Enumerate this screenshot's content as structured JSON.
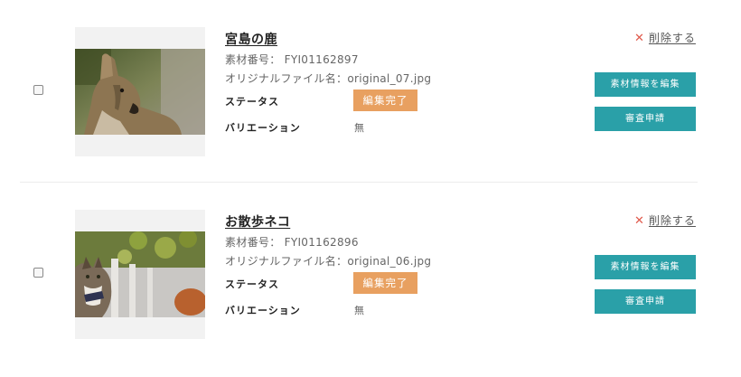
{
  "items": [
    {
      "title": "宮島の鹿",
      "number_label": "素材番号：",
      "number": "FYI01162897",
      "file_label": "オリジナルファイル名：",
      "file": "original_07.jpg",
      "status_label": "ステータス",
      "status": "編集完了",
      "variation_label": "バリエーション",
      "variation": "無",
      "delete_label": "削除する",
      "edit_button": "素材情報を編集",
      "review_button": "審査申請",
      "colors": {
        "status": "#e8a060",
        "button": "#2aa0a8",
        "delete_x": "#e05a4c"
      }
    },
    {
      "title": "お散歩ネコ",
      "number_label": "素材番号：",
      "number": "FYI01162896",
      "file_label": "オリジナルファイル名：",
      "file": "original_06.jpg",
      "status_label": "ステータス",
      "status": "編集完了",
      "variation_label": "バリエーション",
      "variation": "無",
      "delete_label": "削除する",
      "edit_button": "素材情報を編集",
      "review_button": "審査申請",
      "colors": {
        "status": "#e8a060",
        "button": "#2aa0a8",
        "delete_x": "#e05a4c"
      }
    }
  ]
}
